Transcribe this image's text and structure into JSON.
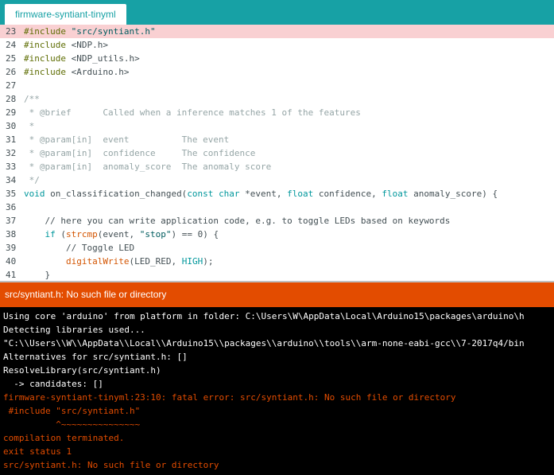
{
  "tab": {
    "label": "firmware-syntiant-tinyml"
  },
  "editor": {
    "lines": [
      {
        "num": "23",
        "highlight": true,
        "tokens": [
          {
            "c": "pp",
            "t": "#include "
          },
          {
            "c": "str",
            "t": "\"src/syntiant.h\""
          }
        ]
      },
      {
        "num": "24",
        "highlight": false,
        "tokens": [
          {
            "c": "pp",
            "t": "#include "
          },
          {
            "c": "tx",
            "t": "<NDP.h>"
          }
        ]
      },
      {
        "num": "25",
        "highlight": false,
        "tokens": [
          {
            "c": "pp",
            "t": "#include "
          },
          {
            "c": "tx",
            "t": "<NDP_utils.h>"
          }
        ]
      },
      {
        "num": "26",
        "highlight": false,
        "tokens": [
          {
            "c": "pp",
            "t": "#include "
          },
          {
            "c": "tx",
            "t": "<Arduino.h>"
          }
        ]
      },
      {
        "num": "27",
        "highlight": false,
        "tokens": []
      },
      {
        "num": "28",
        "highlight": false,
        "tokens": [
          {
            "c": "cm",
            "t": "/**"
          }
        ]
      },
      {
        "num": "29",
        "highlight": false,
        "tokens": [
          {
            "c": "cm",
            "t": " * @brief      Called when a inference matches 1 of the features"
          }
        ]
      },
      {
        "num": "30",
        "highlight": false,
        "tokens": [
          {
            "c": "cm",
            "t": " *"
          }
        ]
      },
      {
        "num": "31",
        "highlight": false,
        "tokens": [
          {
            "c": "cm",
            "t": " * @param[in]  event          The event"
          }
        ]
      },
      {
        "num": "32",
        "highlight": false,
        "tokens": [
          {
            "c": "cm",
            "t": " * @param[in]  confidence     The confidence"
          }
        ]
      },
      {
        "num": "33",
        "highlight": false,
        "tokens": [
          {
            "c": "cm",
            "t": " * @param[in]  anomaly_score  The anomaly score"
          }
        ]
      },
      {
        "num": "34",
        "highlight": false,
        "tokens": [
          {
            "c": "cm",
            "t": " */"
          }
        ]
      },
      {
        "num": "35",
        "highlight": false,
        "tokens": [
          {
            "c": "kw",
            "t": "void"
          },
          {
            "c": "tx",
            "t": " on_classification_changed("
          },
          {
            "c": "kw",
            "t": "const"
          },
          {
            "c": "tx",
            "t": " "
          },
          {
            "c": "kw",
            "t": "char"
          },
          {
            "c": "tx",
            "t": " *event, "
          },
          {
            "c": "kw",
            "t": "float"
          },
          {
            "c": "tx",
            "t": " confidence, "
          },
          {
            "c": "kw",
            "t": "float"
          },
          {
            "c": "tx",
            "t": " anomaly_score) {"
          }
        ]
      },
      {
        "num": "36",
        "highlight": false,
        "tokens": []
      },
      {
        "num": "37",
        "highlight": false,
        "tokens": [
          {
            "c": "tx",
            "t": "    // here you can write application code, e.g. to toggle LEDs based on keywords"
          }
        ]
      },
      {
        "num": "38",
        "highlight": false,
        "tokens": [
          {
            "c": "tx",
            "t": "    "
          },
          {
            "c": "kw",
            "t": "if"
          },
          {
            "c": "tx",
            "t": " ("
          },
          {
            "c": "fn",
            "t": "strcmp"
          },
          {
            "c": "tx",
            "t": "(event, "
          },
          {
            "c": "str",
            "t": "\"stop\""
          },
          {
            "c": "tx",
            "t": ") == 0) {"
          }
        ]
      },
      {
        "num": "39",
        "highlight": false,
        "tokens": [
          {
            "c": "tx",
            "t": "        // Toggle LED"
          }
        ]
      },
      {
        "num": "40",
        "highlight": false,
        "tokens": [
          {
            "c": "tx",
            "t": "        "
          },
          {
            "c": "fn",
            "t": "digitalWrite"
          },
          {
            "c": "tx",
            "t": "(LED_RED, "
          },
          {
            "c": "kw",
            "t": "HIGH"
          },
          {
            "c": "tx",
            "t": ");"
          }
        ]
      },
      {
        "num": "41",
        "highlight": false,
        "tokens": [
          {
            "c": "tx",
            "t": "    }"
          }
        ]
      }
    ]
  },
  "status": {
    "message": "src/syntiant.h: No such file or directory"
  },
  "console": {
    "lines": [
      {
        "c": "white",
        "t": "Using core 'arduino' from platform in folder: C:\\Users\\W\\AppData\\Local\\Arduino15\\packages\\arduino\\h"
      },
      {
        "c": "white",
        "t": "Detecting libraries used..."
      },
      {
        "c": "white",
        "t": "\"C:\\\\Users\\\\W\\\\AppData\\\\Local\\\\Arduino15\\\\packages\\\\arduino\\\\tools\\\\arm-none-eabi-gcc\\\\7-2017q4/bin"
      },
      {
        "c": "white",
        "t": "Alternatives for src/syntiant.h: []"
      },
      {
        "c": "white",
        "t": "ResolveLibrary(src/syntiant.h)"
      },
      {
        "c": "white",
        "t": "  -> candidates: []"
      },
      {
        "c": "red",
        "t": "firmware-syntiant-tinyml:23:10: fatal error: src/syntiant.h: No such file or directory"
      },
      {
        "c": "red",
        "t": " #include \"src/syntiant.h\""
      },
      {
        "c": "red",
        "t": "          ^~~~~~~~~~~~~~~~"
      },
      {
        "c": "red",
        "t": "compilation terminated."
      },
      {
        "c": "red",
        "t": "exit status 1"
      },
      {
        "c": "red",
        "t": "src/syntiant.h: No such file or directory"
      }
    ]
  },
  "colors": {
    "tabbar": "#17a1a5",
    "highlight": "#f9d0d2",
    "status_error": "#e34c00",
    "console_bg": "#000000"
  }
}
